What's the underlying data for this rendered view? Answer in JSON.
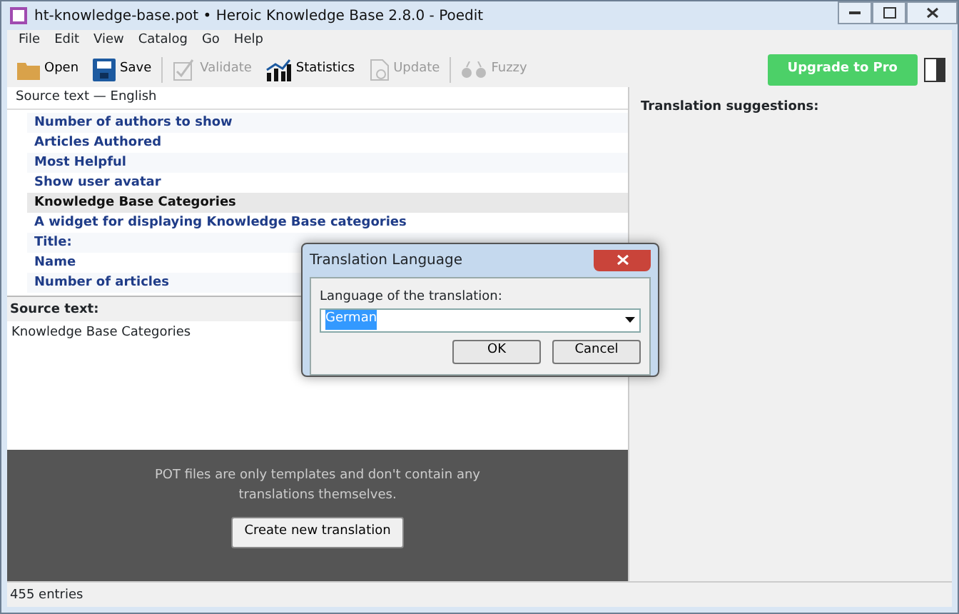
{
  "window": {
    "title": "ht-knowledge-base.pot • Heroic Knowledge Base 2.8.0 - Poedit"
  },
  "menu": [
    "File",
    "Edit",
    "View",
    "Catalog",
    "Go",
    "Help"
  ],
  "toolbar": [
    {
      "label": "Open",
      "kind": "open",
      "disabled": false
    },
    {
      "label": "Save",
      "kind": "save",
      "disabled": false
    },
    {
      "label": "Validate",
      "kind": "validate",
      "disabled": true
    },
    {
      "label": "Statistics",
      "kind": "statistics",
      "disabled": false
    },
    {
      "label": "Update",
      "kind": "update",
      "disabled": true
    },
    {
      "label": "Fuzzy",
      "kind": "fuzzy",
      "disabled": true
    }
  ],
  "upgrade_button": "Upgrade to Pro",
  "list": {
    "header": "Source text — English",
    "rows": [
      {
        "text": "Number of authors to show",
        "selected": false
      },
      {
        "text": "Articles Authored",
        "selected": false
      },
      {
        "text": "Most Helpful",
        "selected": false
      },
      {
        "text": "Show user avatar",
        "selected": false
      },
      {
        "text": "Knowledge Base Categories",
        "selected": true
      },
      {
        "text": "A widget for displaying Knowledge Base categories",
        "selected": false
      },
      {
        "text": "Title:",
        "selected": false
      },
      {
        "text": "Name",
        "selected": false
      },
      {
        "text": "Number of articles",
        "selected": false
      }
    ]
  },
  "source": {
    "label": "Source text:",
    "text": "Knowledge Base Categories"
  },
  "notice": {
    "text": "POT files are only templates and don't contain any translations themselves.",
    "button": "Create new translation"
  },
  "suggestions": {
    "title": "Translation suggestions:"
  },
  "status_bar": "455 entries",
  "dialog": {
    "title": "Translation Language",
    "label": "Language of the translation:",
    "value": "German",
    "buttons": [
      "OK",
      "Cancel"
    ]
  }
}
